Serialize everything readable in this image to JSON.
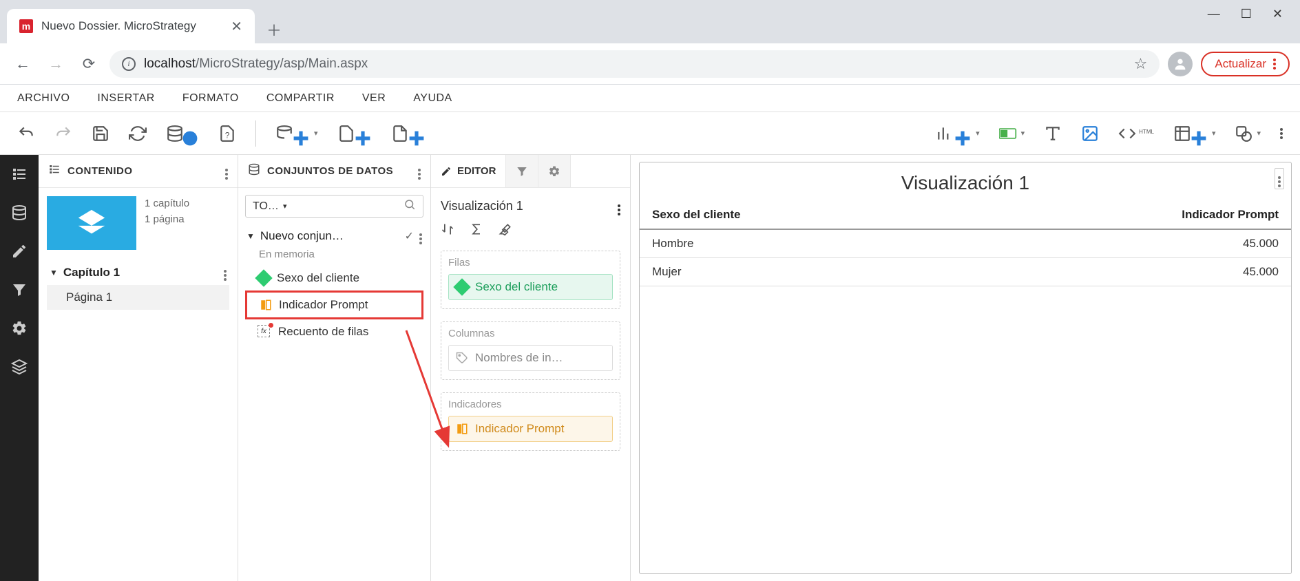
{
  "browser": {
    "tab_title": "Nuevo Dossier. MicroStrategy",
    "url_host": "localhost",
    "url_path": "/MicroStrategy/asp/Main.aspx",
    "update_label": "Actualizar"
  },
  "menu": {
    "items": [
      "ARCHIVO",
      "INSERTAR",
      "FORMATO",
      "COMPARTIR",
      "VER",
      "AYUDA"
    ]
  },
  "content_panel": {
    "title": "CONTENIDO",
    "meta_line1": "1 capítulo",
    "meta_line2": "1 página",
    "chapter": "Capítulo 1",
    "page": "Página 1"
  },
  "datasets_panel": {
    "title": "CONJUNTOS DE DATOS",
    "filter_label": "TO…",
    "group_name": "Nuevo conjun…",
    "memory_label": "En memoria",
    "items": [
      {
        "label": "Sexo del cliente",
        "type": "attribute"
      },
      {
        "label": "Indicador Prompt",
        "type": "metric",
        "highlighted": true
      },
      {
        "label": "Recuento de filas",
        "type": "fx"
      }
    ]
  },
  "editor_panel": {
    "tab_label": "EDITOR",
    "viz_name": "Visualización 1",
    "rows_label": "Filas",
    "rows_chip": "Sexo del cliente",
    "cols_label": "Columnas",
    "cols_chip": "Nombres de in…",
    "metrics_label": "Indicadores",
    "metrics_chip": "Indicador Prompt"
  },
  "visualization": {
    "title": "Visualización 1",
    "col1": "Sexo del cliente",
    "col2": "Indicador Prompt",
    "rows": [
      {
        "label": "Hombre",
        "value": "45.000"
      },
      {
        "label": "Mujer",
        "value": "45.000"
      }
    ]
  }
}
